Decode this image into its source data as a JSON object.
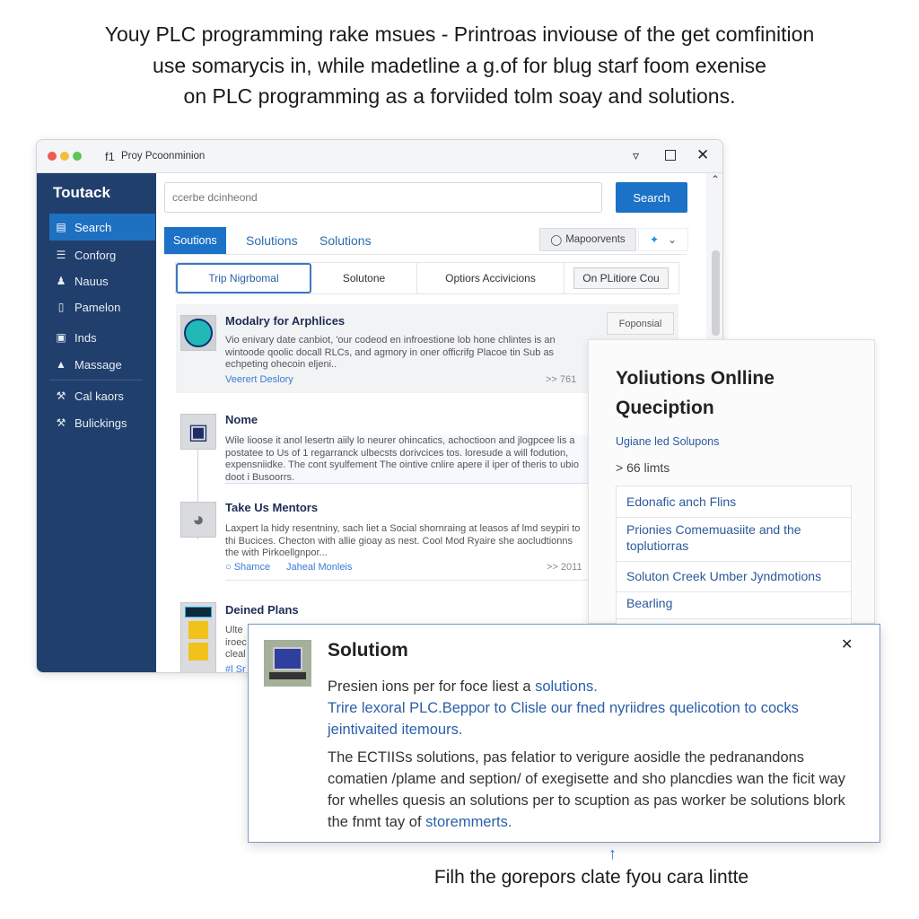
{
  "headline": [
    "Youy PLC programming rake msues - Printroas inviouse of the get comfinition",
    "use somarycis in, while madetline a g.of for blug starf foom exenise",
    "on PLC programming as a forviided tolm soay and solutions."
  ],
  "window": {
    "title": "Proy Pcoonminion",
    "title_icon": "f1",
    "controls": [
      "minimize-icon",
      "maximize-icon",
      "close-icon"
    ]
  },
  "sidebar": {
    "brand": "Toutack",
    "items": [
      {
        "label": "Search",
        "icon": "clipboard-icon",
        "active": true
      },
      {
        "label": "Conforg",
        "icon": "settings-icon"
      },
      {
        "label": "Nauus",
        "icon": "user-icon"
      },
      {
        "label": "Pamelon",
        "icon": "phone-icon"
      },
      {
        "label": "Inds",
        "icon": "folder-icon"
      },
      {
        "label": "Massage",
        "icon": "bag-icon"
      },
      {
        "label": "Cal kaors",
        "icon": "wrench-icon"
      },
      {
        "label": "Bulickings",
        "icon": "wrench-icon"
      }
    ]
  },
  "search": {
    "placeholder": "ccerbe dcinheond",
    "button": "Search"
  },
  "tabs": [
    {
      "label": "Soutions",
      "active": true
    },
    {
      "label": "Solutions"
    },
    {
      "label": "Solutions"
    }
  ],
  "toolbar": {
    "map_button": "Mapoorvents"
  },
  "subtabs": [
    {
      "label": "Trip Nigrbomal",
      "active": true
    },
    {
      "label": "Solutone"
    },
    {
      "label": "Optiors Accivicions"
    },
    {
      "label": "On PLitiore Cou"
    }
  ],
  "results": [
    {
      "title": "Modalry for Arphlices",
      "text": "Vio enivary date canbiot, 'our codeod en infroestione lob hone chlintes is an wintoode qoolic docall RLCs, and agmory in oner officrifg Placoe tin Sub as echpeting ohecoin eljeni..",
      "links": [
        "Veerert Deslory"
      ],
      "count": ">> 761",
      "button": "Foponsial"
    },
    {
      "title": "Nome",
      "text": "Wile lioose it anol lesertn aiily lo neurer ohincatics, achoctioon and jlogpcee lis a postatee to Us of 1 regarranck ulbecsts dorivcices tos. loresude a will fodution, expensniidke. The cont syulfement The ointive cnlire apere il iper of theris to ubio doot i Busoorrs."
    },
    {
      "title": "Take Us Mentors",
      "text": "Laxpert la hidy resentniny, sach liet a Social shornraing at leasos af lmd seypiri to thi Bucices. Checton with allie gioay as nest. Cool Mod Ryaire she aocludtionns the with Pirkoellgnpor...",
      "links": [
        "Shamce",
        "Jaheal Monleis"
      ],
      "count": ">> 2011"
    },
    {
      "title": "Deined Plans",
      "text": "Ulte iroec cleal",
      "links": [
        "#l Sr"
      ]
    }
  ],
  "side_panel": {
    "title": "Yoliutions Onlline Queciption",
    "subtitle": "Ugiane led Solupons",
    "count": "> 66 limts",
    "items": [
      "Edonafic anch Flins",
      "Prionies Comemuasiite and the toplutiorras",
      "Soluton Creek Umber Jyndmotions",
      "Bearling"
    ]
  },
  "modal": {
    "title": "Solutiom",
    "line1_plain": "Presien ions per for foce liest a ",
    "line1_link": "solutions.",
    "link_paragraph": "Trire lexoral PLC.Beppor to Clisle our fned nyriidres quelicotion to cocks jeintivaited itemours.",
    "body_plain": "The ECTIISs solutions, pas felatior to verigure aosidle the pedranandons comatien /plame and seption/ of exegisette and sho plancdies wan the ficit way for whelles quesis an solutions per to scuption as pas worker be solutions blork the fnmt tay of ",
    "body_link": "storemmerts."
  },
  "caption": "Filh the gorepors clate fyou cara lintte",
  "colors": {
    "sidebar": "#213f6c",
    "accent": "#1e70c1",
    "link": "#2a5fa8"
  }
}
